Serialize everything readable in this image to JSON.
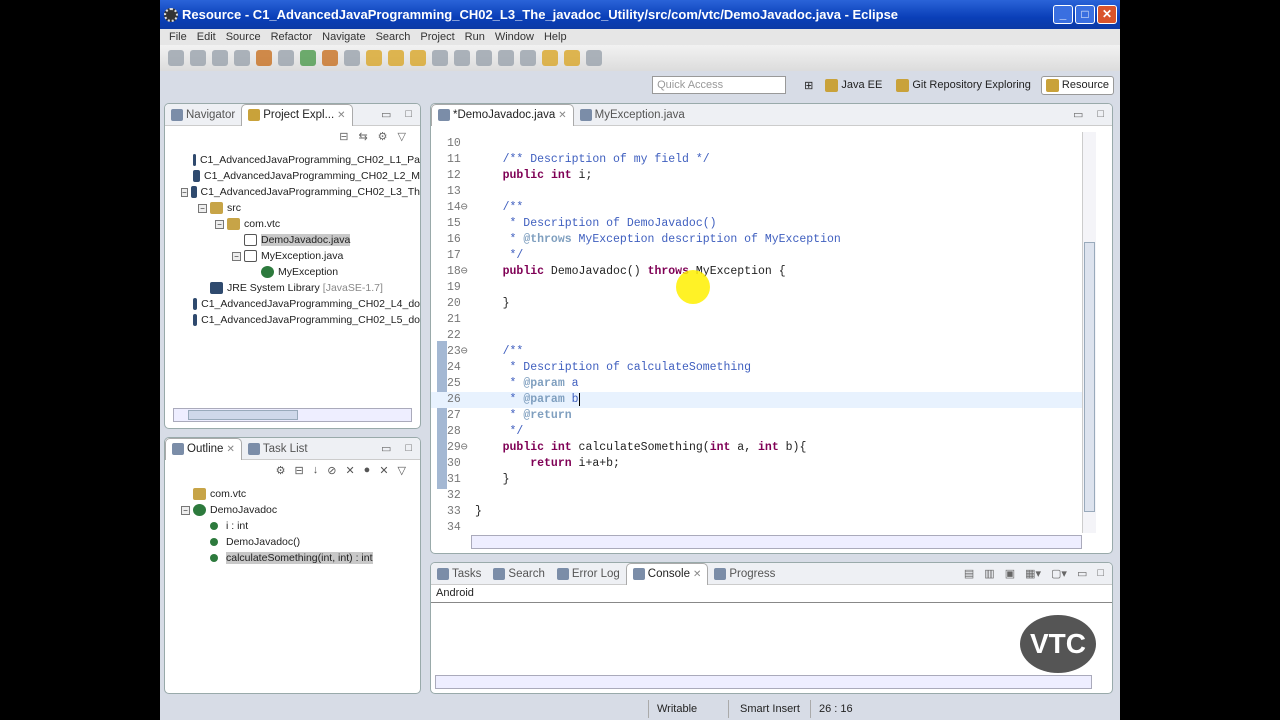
{
  "window": {
    "title": "Resource - C1_AdvancedJavaProgramming_CH02_L3_The_javadoc_Utility/src/com/vtc/DemoJavadoc.java - Eclipse"
  },
  "menu": [
    "File",
    "Edit",
    "Source",
    "Refactor",
    "Navigate",
    "Search",
    "Project",
    "Run",
    "Window",
    "Help"
  ],
  "quick_access": {
    "placeholder": "Quick Access"
  },
  "perspectives": [
    {
      "label": "Java EE"
    },
    {
      "label": "Git Repository Exploring"
    },
    {
      "label": "Resource",
      "active": true
    }
  ],
  "explorer": {
    "tabs": [
      "Navigator",
      "Project Expl..."
    ],
    "tree": [
      {
        "label": "C1_AdvancedJavaProgramming_CH02_L1_Pa",
        "depth": 0,
        "icon": "project-icon"
      },
      {
        "label": "C1_AdvancedJavaProgramming_CH02_L2_M",
        "depth": 0,
        "icon": "project-icon"
      },
      {
        "label": "C1_AdvancedJavaProgramming_CH02_L3_Th",
        "depth": 0,
        "icon": "project-icon",
        "expanded": true
      },
      {
        "label": "src",
        "depth": 1,
        "icon": "source-folder-icon",
        "expanded": true
      },
      {
        "label": "com.vtc",
        "depth": 2,
        "icon": "package-icon",
        "expanded": true
      },
      {
        "label": "DemoJavadoc.java",
        "depth": 3,
        "icon": "java-file-icon",
        "selected": true
      },
      {
        "label": "MyException.java",
        "depth": 3,
        "icon": "java-file-icon",
        "expanded": true
      },
      {
        "label": "MyException",
        "depth": 4,
        "icon": "class-icon"
      },
      {
        "label": "JRE System Library",
        "extra": "[JavaSE-1.7]",
        "depth": 1,
        "icon": "library-icon"
      },
      {
        "label": "C1_AdvancedJavaProgramming_CH02_L4_do",
        "depth": 0,
        "icon": "project-icon"
      },
      {
        "label": "C1_AdvancedJavaProgramming_CH02_L5_do",
        "depth": 0,
        "icon": "project-icon"
      }
    ]
  },
  "outline": {
    "tabs": [
      "Outline",
      "Task List"
    ],
    "tree": [
      {
        "label": "com.vtc",
        "depth": 0,
        "icon": "package-icon"
      },
      {
        "label": "DemoJavadoc",
        "depth": 0,
        "icon": "class-icon",
        "expanded": true
      },
      {
        "label": "i : int",
        "depth": 1,
        "icon": "field-icon"
      },
      {
        "label": "DemoJavadoc()",
        "depth": 1,
        "icon": "constructor-icon"
      },
      {
        "label": "calculateSomething(int, int) : int",
        "depth": 1,
        "icon": "method-icon",
        "selected": true
      }
    ]
  },
  "editor": {
    "tabs": [
      "*DemoJavadoc.java",
      "MyException.java"
    ],
    "cursor_line": 26,
    "lines": [
      {
        "n": "10",
        "s": []
      },
      {
        "n": "11",
        "s": [
          [
            "    ",
            ""
          ],
          [
            "/** Description of my field */",
            "doc"
          ]
        ]
      },
      {
        "n": "12",
        "s": [
          [
            "    ",
            ""
          ],
          [
            "public",
            "kw"
          ],
          [
            " ",
            ""
          ],
          [
            "int",
            "kw"
          ],
          [
            " i;",
            ""
          ]
        ]
      },
      {
        "n": "13",
        "s": []
      },
      {
        "n": "14⊖",
        "s": [
          [
            "    ",
            ""
          ],
          [
            "/**",
            "doc"
          ]
        ]
      },
      {
        "n": "15",
        "s": [
          [
            "     * Description of DemoJavadoc()",
            "doc"
          ]
        ]
      },
      {
        "n": "16",
        "s": [
          [
            "     * ",
            "doc"
          ],
          [
            "@throws",
            "tag"
          ],
          [
            " MyException description of MyException",
            "doc"
          ]
        ]
      },
      {
        "n": "17",
        "s": [
          [
            "     */",
            "doc"
          ]
        ]
      },
      {
        "n": "18⊖",
        "s": [
          [
            "    ",
            ""
          ],
          [
            "public",
            "kw"
          ],
          [
            " DemoJavadoc() ",
            ""
          ],
          [
            "throws",
            "kw"
          ],
          [
            " MyException {",
            ""
          ]
        ]
      },
      {
        "n": "19",
        "s": []
      },
      {
        "n": "20",
        "s": [
          [
            "    }",
            ""
          ]
        ]
      },
      {
        "n": "21",
        "s": []
      },
      {
        "n": "22",
        "s": []
      },
      {
        "n": "23⊖",
        "s": [
          [
            "    ",
            ""
          ],
          [
            "/**",
            "doc"
          ]
        ]
      },
      {
        "n": "24",
        "s": [
          [
            "     * Description of calculateSomething",
            "doc"
          ]
        ]
      },
      {
        "n": "25",
        "s": [
          [
            "     * ",
            "doc"
          ],
          [
            "@param",
            "tag"
          ],
          [
            " a",
            "doc"
          ]
        ]
      },
      {
        "n": "26",
        "s": [
          [
            "     * ",
            "doc"
          ],
          [
            "@param",
            "tag"
          ],
          [
            " b",
            "doc"
          ]
        ]
      },
      {
        "n": "27",
        "s": [
          [
            "     * ",
            "doc"
          ],
          [
            "@return",
            "tag"
          ]
        ]
      },
      {
        "n": "28",
        "s": [
          [
            "     */",
            "doc"
          ]
        ]
      },
      {
        "n": "29⊖",
        "s": [
          [
            "    ",
            ""
          ],
          [
            "public",
            "kw"
          ],
          [
            " ",
            ""
          ],
          [
            "int",
            "kw"
          ],
          [
            " calculateSomething(",
            ""
          ],
          [
            "int",
            "kw"
          ],
          [
            " a, ",
            ""
          ],
          [
            "int",
            "kw"
          ],
          [
            " b){",
            ""
          ]
        ]
      },
      {
        "n": "30",
        "s": [
          [
            "        ",
            ""
          ],
          [
            "return",
            "kw"
          ],
          [
            " i+a+b;",
            ""
          ]
        ]
      },
      {
        "n": "31",
        "s": [
          [
            "    }",
            ""
          ]
        ]
      },
      {
        "n": "32",
        "s": []
      },
      {
        "n": "33",
        "s": [
          [
            "}",
            ""
          ]
        ]
      },
      {
        "n": "34",
        "s": []
      }
    ]
  },
  "console": {
    "tabs": [
      "Tasks",
      "Search",
      "Error Log",
      "Console",
      "Progress"
    ],
    "active": "Console",
    "header": "Android",
    "logo": "VTC"
  },
  "status": {
    "mode": "Writable",
    "insert": "Smart Insert",
    "position": "26 : 16"
  },
  "colors": {
    "keyword": "#7f0055",
    "javadoc": "#3f5fbf",
    "titlebar": "#0a3fb8"
  }
}
